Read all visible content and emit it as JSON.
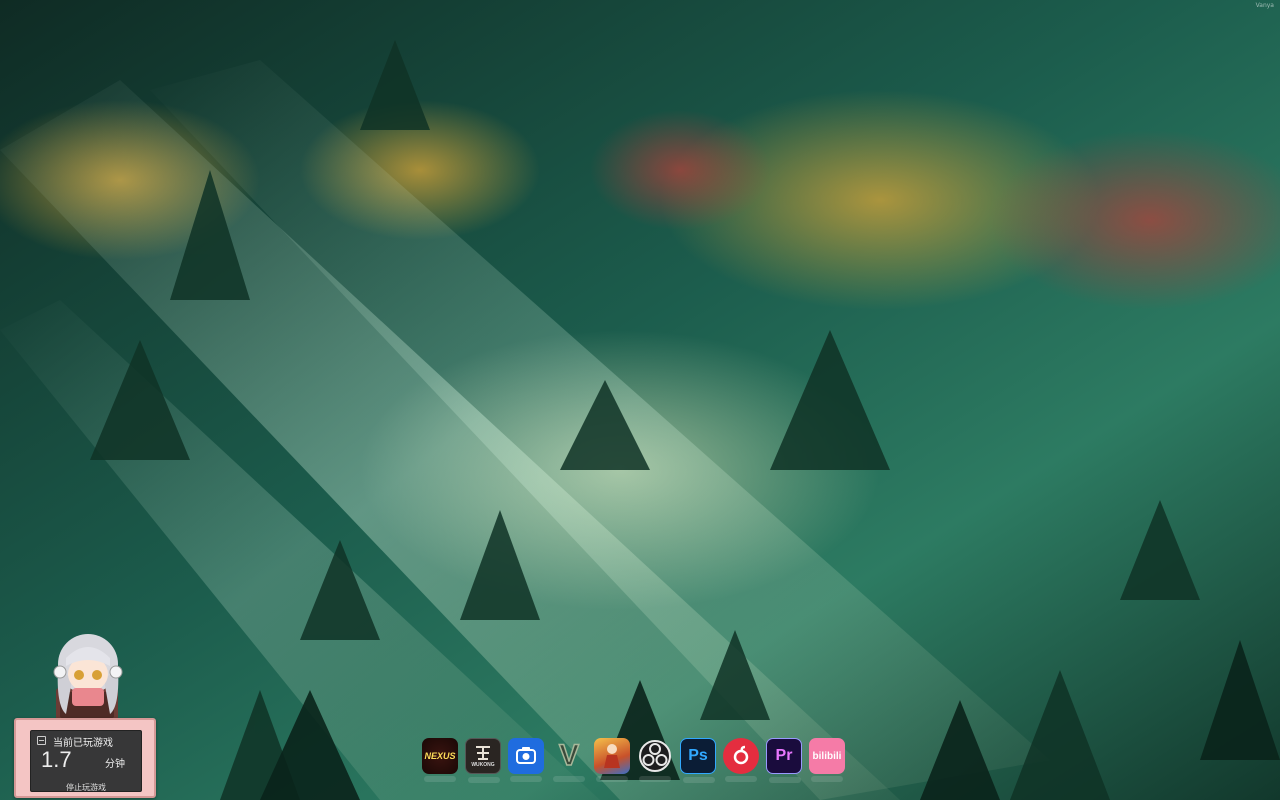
{
  "desktop": {
    "corner_text": "Vanya"
  },
  "widget": {
    "title": "当前已玩游戏",
    "value": "1.7",
    "unit": "分钟",
    "stop_label": "停止玩游戏"
  },
  "dock": {
    "items": [
      {
        "name": "nexus-icon",
        "label": "NEXUS",
        "color": "#b8261f"
      },
      {
        "name": "black-myth-wukong-icon",
        "label": "WUKONG",
        "color": "#2a2522"
      },
      {
        "name": "screenshot-app-icon",
        "label": "",
        "color": "#1f6cdf"
      },
      {
        "name": "gta-v-icon",
        "label": "V",
        "color": "#2f3a2f"
      },
      {
        "name": "game-character-icon",
        "label": "",
        "color": "#d98a2c"
      },
      {
        "name": "obs-icon",
        "label": "",
        "color": "#1d1d1f"
      },
      {
        "name": "photoshop-icon",
        "label": "Ps",
        "color": "#0b1d36"
      },
      {
        "name": "netease-music-icon",
        "label": "",
        "color": "#e42d3f"
      },
      {
        "name": "premiere-icon",
        "label": "Pr",
        "color": "#1a0c3d"
      },
      {
        "name": "bilibili-icon",
        "label": "bilibili",
        "color": "#f57ba7"
      }
    ]
  }
}
